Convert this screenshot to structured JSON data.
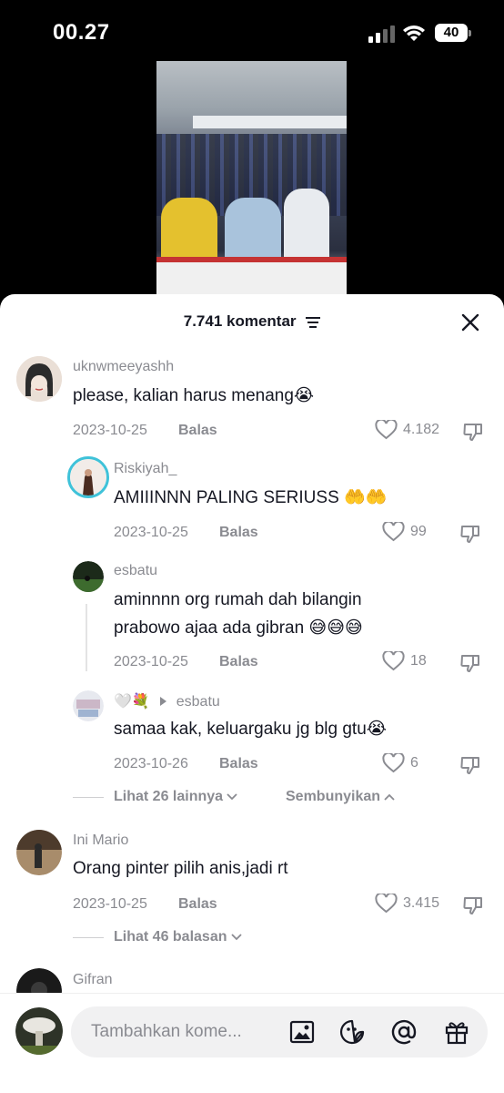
{
  "status_bar": {
    "time": "00.27",
    "battery": "40"
  },
  "sheet": {
    "title": "7.741 komentar"
  },
  "comments": [
    {
      "username": "uknwmeeyashh",
      "text": "please, kalian harus menang😭",
      "date": "2023-10-25",
      "reply_label": "Balas",
      "likes": "4.182"
    },
    {
      "username": "Ini Mario",
      "text": "Orang pinter pilih anis,jadi rt",
      "date": "2023-10-25",
      "reply_label": "Balas",
      "likes": "3.415",
      "view_replies": "Lihat 46 balasan"
    },
    {
      "username": "Gifran"
    }
  ],
  "replies": [
    {
      "username": "Riskiyah_",
      "text": "AMIIINNN PALING SERIUSS 🤲🤲",
      "date": "2023-10-25",
      "reply_label": "Balas",
      "likes": "99"
    },
    {
      "username": "esbatu",
      "text_line1": "aminnnn org rumah dah bilangin",
      "text_line2": "prabowo ajaa ada gibran 😅😅😅",
      "date": "2023-10-25",
      "reply_label": "Balas",
      "likes": "18"
    },
    {
      "username": "🤍💐",
      "reply_to": "esbatu",
      "text": "samaa kak, keluargaku jg blg gtu😭",
      "date": "2023-10-26",
      "reply_label": "Balas",
      "likes": "6"
    }
  ],
  "thread_controls": {
    "view_more": "Lihat 26 lainnya",
    "hide": "Sembunyikan"
  },
  "input": {
    "placeholder": "Tambahkan kome..."
  },
  "icons": [
    "filter-icon",
    "close-icon",
    "heart-icon",
    "dislike-icon",
    "image-icon",
    "sticker-icon",
    "mention-icon",
    "gift-icon"
  ]
}
